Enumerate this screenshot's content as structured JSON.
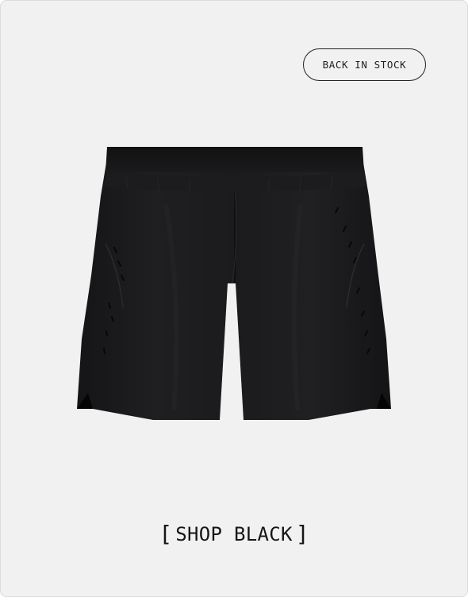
{
  "badge": {
    "label": "BACK IN STOCK"
  },
  "product": {
    "color": "#1c1c1e"
  },
  "cta": {
    "open_bracket": "[",
    "label": "SHOP BLACK",
    "close_bracket": "]"
  },
  "colors": {
    "background": "#f1f1f1",
    "text": "#161616",
    "border": "#dcdcdc"
  }
}
